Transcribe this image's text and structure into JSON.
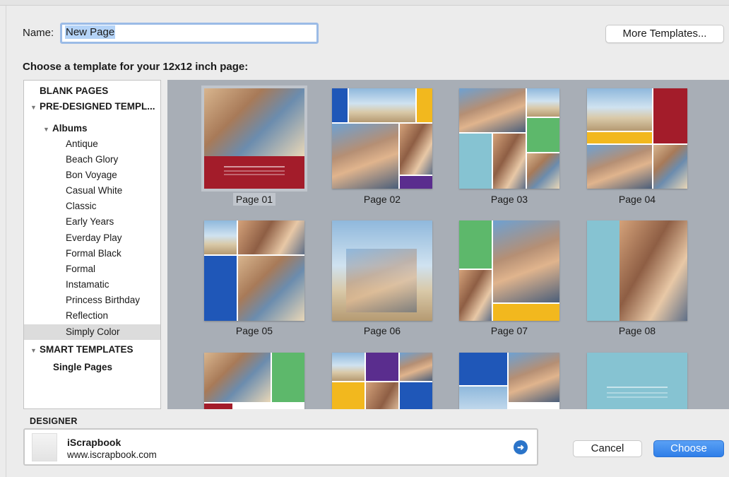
{
  "name_field": {
    "label": "Name:",
    "value": "New Page"
  },
  "more_templates_label": "More Templates...",
  "heading": "Choose a template for your 12x12 inch page:",
  "sidebar": {
    "items": [
      {
        "label": "BLANK PAGES"
      },
      {
        "label": "PRE-DESIGNED TEMPL..."
      },
      {
        "label": "Albums"
      },
      {
        "label": "Antique"
      },
      {
        "label": "Beach Glory"
      },
      {
        "label": "Bon Voyage"
      },
      {
        "label": "Casual White"
      },
      {
        "label": "Classic"
      },
      {
        "label": "Early Years"
      },
      {
        "label": "Everday Play"
      },
      {
        "label": "Formal Black"
      },
      {
        "label": "Formal"
      },
      {
        "label": "Instamatic"
      },
      {
        "label": "Princess Birthday"
      },
      {
        "label": "Reflection"
      },
      {
        "label": "Simply Color",
        "selected": true
      },
      {
        "label": "SMART TEMPLATES"
      },
      {
        "label": "Single Pages"
      }
    ]
  },
  "templates": [
    {
      "label": "Page 01",
      "selected": true
    },
    {
      "label": "Page 02"
    },
    {
      "label": "Page 03"
    },
    {
      "label": "Page 04"
    },
    {
      "label": "Page 05"
    },
    {
      "label": "Page 06"
    },
    {
      "label": "Page 07"
    },
    {
      "label": "Page 08"
    }
  ],
  "designer": {
    "section_label": "DESIGNER",
    "name": "iScrapbook",
    "url": "www.iscrapbook.com"
  },
  "buttons": {
    "cancel": "Cancel",
    "choose": "Choose"
  },
  "colors": {
    "accent": "#2f7ee8",
    "template_red": "#a31c2a",
    "template_blue": "#1f57b8",
    "template_yellow": "#f2b81e",
    "template_green": "#5db86b",
    "template_aqua": "#86c3d2",
    "template_purple": "#5a2d8e"
  }
}
